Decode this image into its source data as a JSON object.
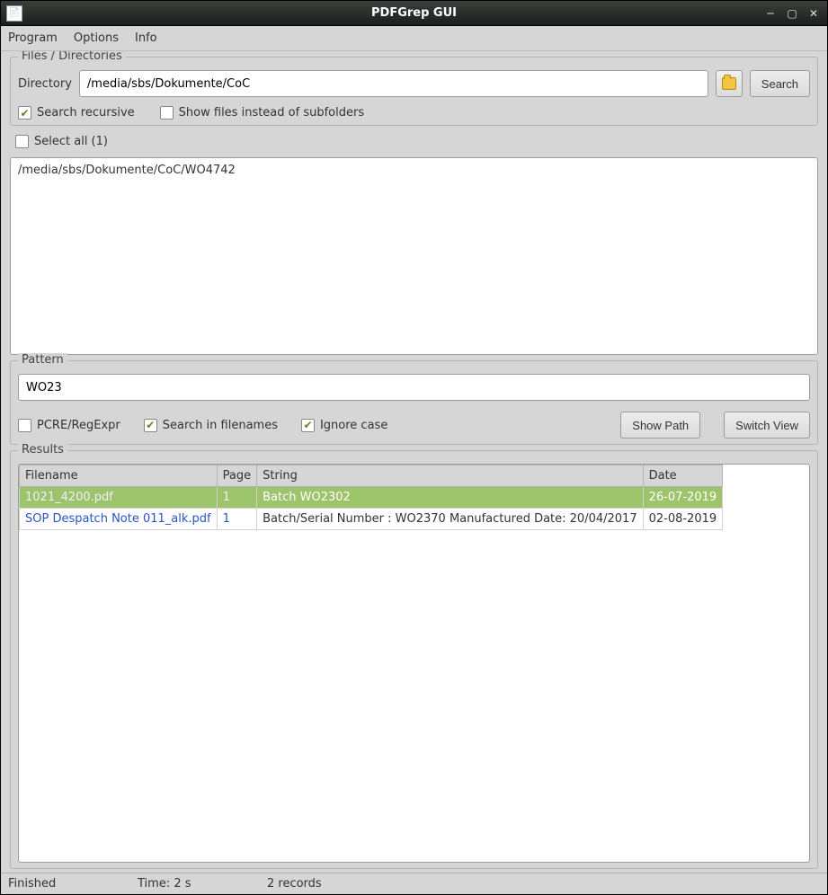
{
  "window": {
    "title": "PDFGrep GUI"
  },
  "menu": {
    "items": [
      "Program",
      "Options",
      "Info"
    ]
  },
  "files_group": {
    "title": "Files / Directories",
    "dir_label": "Directory",
    "dir_value": "/media/sbs/Dokumente/CoC",
    "search_btn": "Search",
    "recursive_label": "Search recursive",
    "recursive_checked": true,
    "showfiles_label": "Show files instead of subfolders",
    "showfiles_checked": false
  },
  "selectall": {
    "label": "Select all (1)",
    "checked": false
  },
  "dir_list": {
    "items": [
      "/media/sbs/Dokumente/CoC/WO4742"
    ]
  },
  "pattern_group": {
    "title": "Pattern",
    "value": "WO23",
    "pcre_label": "PCRE/RegExpr",
    "pcre_checked": false,
    "filenames_label": "Search in filenames",
    "filenames_checked": true,
    "ignorecase_label": "Ignore case",
    "ignorecase_checked": true,
    "showpath_btn": "Show Path",
    "switchview_btn": "Switch View"
  },
  "results_group": {
    "title": "Results",
    "columns": [
      "Filename",
      "Page",
      "String",
      "Date"
    ],
    "rows": [
      {
        "filename": "1021_4200.pdf",
        "page": "1",
        "string": "Batch WO2302",
        "date": "26-07-2019",
        "selected": true
      },
      {
        "filename": "SOP Despatch Note 011_alk.pdf",
        "page": "1",
        "string": "Batch/Serial Number : WO2370 Manufactured Date: 20/04/2017",
        "date": "02-08-2019",
        "selected": false
      }
    ]
  },
  "status": {
    "state": "Finished",
    "time": "Time: 2 s",
    "records": "2  records"
  }
}
